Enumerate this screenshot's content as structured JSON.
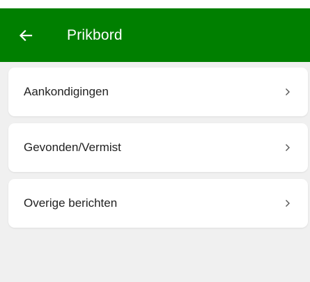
{
  "appbar": {
    "title": "Prikbord",
    "back_icon": "arrow-left-icon",
    "background_color": "#007f00",
    "text_color": "#ffffff"
  },
  "content": {
    "background_color": "#f0f0f0",
    "items": [
      {
        "label": "Aankondigingen",
        "chevron_icon": "chevron-right-icon"
      },
      {
        "label": "Gevonden/Vermist",
        "chevron_icon": "chevron-right-icon"
      },
      {
        "label": "Overige berichten",
        "chevron_icon": "chevron-right-icon"
      }
    ]
  }
}
